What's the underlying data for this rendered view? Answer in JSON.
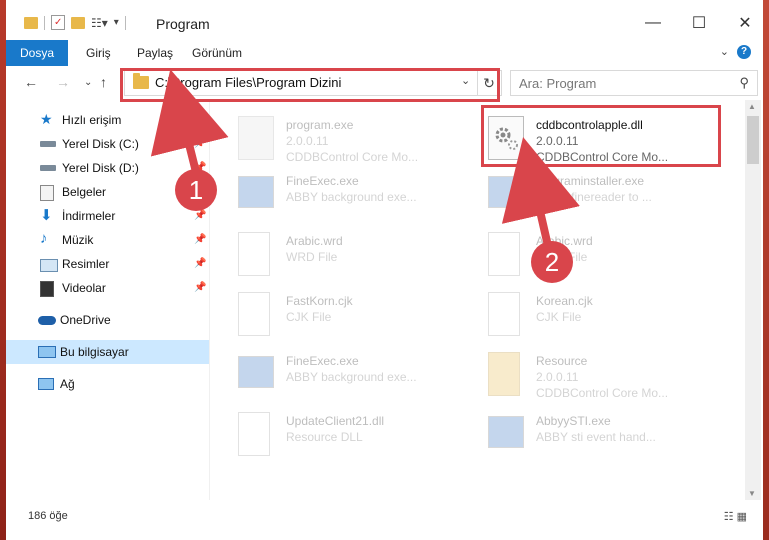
{
  "window": {
    "title": "Program",
    "controls": {
      "minimize": "—",
      "maximize": "☐",
      "close": "✕"
    }
  },
  "ribbon": {
    "tabs": [
      "Dosya",
      "Giriş",
      "Paylaş",
      "Görünüm"
    ],
    "help": "?"
  },
  "navigation": {
    "address": "C:\\Program Files\\Program Dizini",
    "search_placeholder": "Ara: Program"
  },
  "sidebar": {
    "items": [
      {
        "label": "Hızlı erişim",
        "icon": "star-icon"
      },
      {
        "label": "Yerel Disk (C:)",
        "icon": "drive-icon",
        "pinned": true
      },
      {
        "label": "Yerel Disk (D:)",
        "icon": "drive-icon",
        "pinned": true
      },
      {
        "label": "Belgeler",
        "icon": "documents-icon",
        "pinned": true
      },
      {
        "label": "İndirmeler",
        "icon": "download-icon",
        "pinned": true
      },
      {
        "label": "Müzik",
        "icon": "music-icon",
        "pinned": true
      },
      {
        "label": "Resimler",
        "icon": "pictures-icon",
        "pinned": true
      },
      {
        "label": "Videolar",
        "icon": "videos-icon",
        "pinned": true
      },
      {
        "label": "OneDrive",
        "icon": "cloud-icon"
      },
      {
        "label": "Bu bilgisayar",
        "icon": "computer-icon",
        "selected": true
      },
      {
        "label": "Ağ",
        "icon": "network-icon"
      }
    ]
  },
  "files": [
    {
      "name": "program.exe",
      "version": "2.0.0.11",
      "desc": "CDDBControl Core Mo...",
      "icon": "exe-icon"
    },
    {
      "name": "cddbcontrolapple.dll",
      "version": "2.0.0.11",
      "desc": "CDDBControl Core Mo...",
      "icon": "dll-gear-icon",
      "highlighted": true
    },
    {
      "name": "FineExec.exe",
      "version": "",
      "desc": "ABBY background exe...",
      "icon": "exe-icon"
    },
    {
      "name": "programinstaller.exe",
      "version": "",
      "desc": "ABBY finereader to ...",
      "icon": "exe-icon"
    },
    {
      "name": "Arabic.wrd",
      "version": "",
      "desc": "WRD File",
      "icon": "file-icon"
    },
    {
      "name": "Arabic.wrd",
      "version": "",
      "desc": "WRD File",
      "icon": "file-icon"
    },
    {
      "name": "FastKorn.cjk",
      "version": "",
      "desc": "CJK File",
      "icon": "file-icon"
    },
    {
      "name": "Korean.cjk",
      "version": "",
      "desc": "CJK File",
      "icon": "file-icon"
    },
    {
      "name": "FineExec.exe",
      "version": "",
      "desc": "ABBY background exe...",
      "icon": "exe-icon"
    },
    {
      "name": "Resource",
      "version": "2.0.0.11",
      "desc": "CDDBControl Core Mo...",
      "icon": "folder-icon"
    },
    {
      "name": "UpdateClient21.dll",
      "version": "",
      "desc": "Resource DLL",
      "icon": "dll-gear-icon"
    },
    {
      "name": "AbbyySTI.exe",
      "version": "",
      "desc": "ABBY sti event hand...",
      "icon": "exe-icon"
    }
  ],
  "status": {
    "count": "186 öğe"
  },
  "annotations": {
    "step1": "1",
    "step2": "2"
  },
  "colors": {
    "accent": "#1979ca",
    "annotation_red": "#d9454b",
    "selection": "#cce8ff"
  }
}
